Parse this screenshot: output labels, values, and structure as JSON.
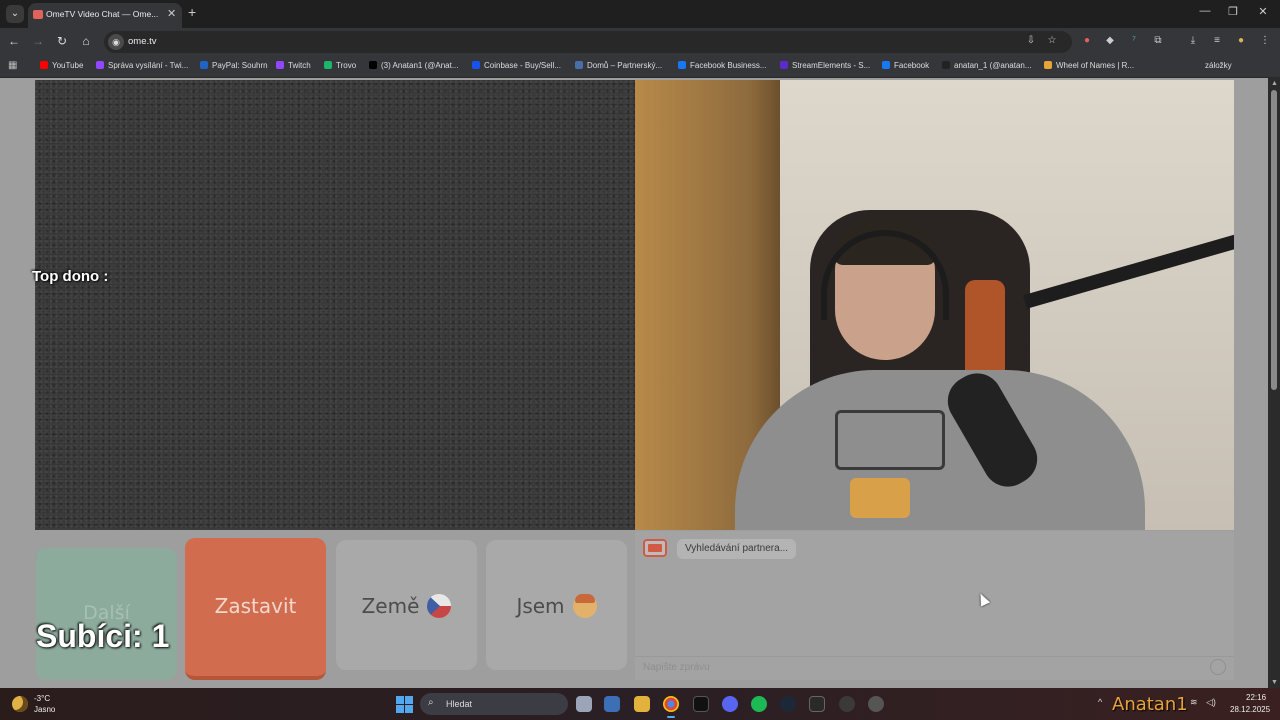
{
  "browser": {
    "tab_title": "OmeTV Video Chat — Ome...",
    "url": "ome.tv",
    "bookmarks": [
      {
        "label": "YouTube",
        "color": "#ff0000"
      },
      {
        "label": "Správa vysílání - Twi...",
        "color": "#9146ff"
      },
      {
        "label": "PayPal: Souhrn",
        "color": "#1f63c6"
      },
      {
        "label": "Twitch",
        "color": "#9146ff"
      },
      {
        "label": "Trovo",
        "color": "#1bb56b"
      },
      {
        "label": "(3) Anatan1 (@Anat...",
        "color": "#000000"
      },
      {
        "label": "Coinbase - Buy/Sell...",
        "color": "#1652f0"
      },
      {
        "label": "Domů – Partnerský...",
        "color": "#4a6ea9"
      },
      {
        "label": "Facebook Business...",
        "color": "#1877f2"
      },
      {
        "label": "StreamElements - S...",
        "color": "#5b2bd1"
      },
      {
        "label": "Facebook",
        "color": "#1877f2"
      },
      {
        "label": "anatan_1 (@anatan...",
        "color": "#222222"
      },
      {
        "label": "Wheel of Names | R...",
        "color": "#e8a33a"
      }
    ],
    "other_bookmarks": "záložky"
  },
  "overlay": {
    "top_dono": "Top dono :",
    "subs": "Subíci: 1",
    "watermark": "Anatan1"
  },
  "controls": {
    "next_label": "Další",
    "stop_label": "Zastavit",
    "country_label": "Země",
    "me_label": "Jsem"
  },
  "chat": {
    "status_message": "Vyhledávání partnera...",
    "input_placeholder": "Napište zprávu"
  },
  "taskbar": {
    "weather_temp": "-3°C",
    "weather_desc": "Jasno",
    "search_placeholder": "Hledat",
    "time": "22:16",
    "date": "28.12.2025"
  },
  "colors": {
    "stop_button": "#d16c4f",
    "next_button": "#8cab9c",
    "watermark": "#e8a33a"
  }
}
